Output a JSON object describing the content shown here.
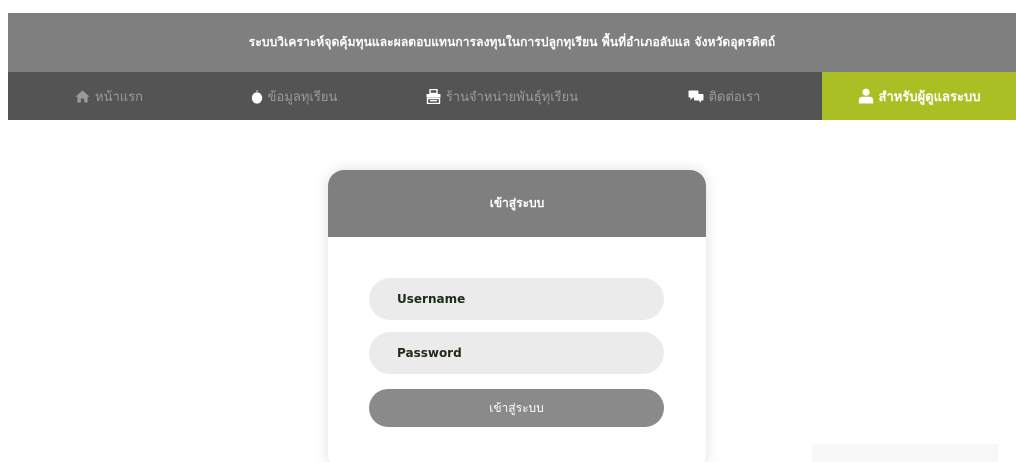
{
  "header": {
    "title": "ระบบวิเคราะห์จุดคุ้มทุนและผลตอบแทนการลงทุนในการปลูกทุเรียน พื้นที่อำเภอลับแล จังหวัดอุตรดิตถ์"
  },
  "nav": {
    "items": [
      {
        "label": "หน้าแรก",
        "icon": "home-icon"
      },
      {
        "label": "ข้อมูลทุเรียน",
        "icon": "durian-icon"
      },
      {
        "label": "ร้านจำหน่ายพันธุ์ทุเรียน",
        "icon": "shop-icon"
      },
      {
        "label": "ติดต่อเรา",
        "icon": "chat-icon"
      },
      {
        "label": "สำหรับผู้ดูแลระบบ",
        "icon": "user-icon",
        "active": true
      }
    ],
    "active_color": "#a9bf24"
  },
  "login": {
    "title": "เข้าสู่ระบบ",
    "username_placeholder": "Username",
    "password_placeholder": "Password",
    "button_label": "เข้าสู่ระบบ"
  },
  "colors": {
    "header_bg": "#7f7f7f",
    "nav_bg": "#545454",
    "accent": "#a9bf24"
  }
}
